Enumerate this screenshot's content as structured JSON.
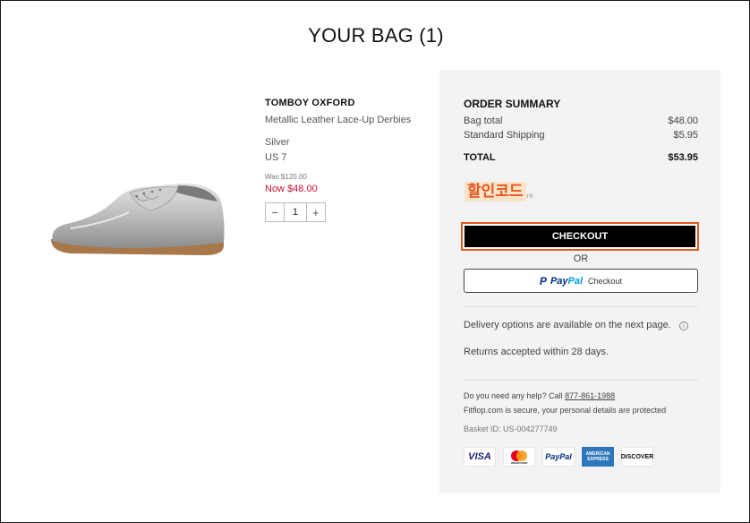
{
  "header": {
    "title": "YOUR BAG (1)"
  },
  "product": {
    "name": "TOMBOY OXFORD",
    "description": "Metallic Leather Lace-Up Derbies",
    "color": "Silver",
    "size": "US 7",
    "was_price": "Was $120.00",
    "now_price": "Now $48.00",
    "quantity": "1",
    "minus_symbol": "−",
    "plus_symbol": "+",
    "image_icon": "silver-shoe-image"
  },
  "summary": {
    "title": "ORDER SUMMARY",
    "bag_total_label": "Bag total",
    "bag_total_value": "$48.00",
    "shipping_label": "Standard Shipping",
    "shipping_value": "$5.95",
    "total_label": "TOTAL",
    "total_value": "$53.95",
    "promo_label": "할인코드",
    "promo_suffix": "re",
    "checkout_label": "CHECKOUT",
    "or_text": "OR",
    "paypal_pay": "Pay",
    "paypal_pal": "Pal",
    "paypal_checkout": "Checkout",
    "delivery_text": "Delivery options are available on the next page.",
    "info_symbol": "i",
    "returns_text": "Returns accepted within 28 days.",
    "help_text": "Do you need any help? Call ",
    "help_phone": "877-861-1988",
    "secure_text": "Fitflop.com is secure, your personal details are protected",
    "basket_id": "Basket ID: US-004277749",
    "cards": [
      "VISA",
      "mastercard",
      "PayPal",
      "AMERICAN EXPRESS",
      "DISCOVER"
    ]
  },
  "colors": {
    "accent_orange": "#e2571b",
    "sale_red": "#c8102e",
    "panel_bg": "#f3f3f3",
    "paypal_blue": "#003087",
    "paypal_light_blue": "#009cde"
  }
}
